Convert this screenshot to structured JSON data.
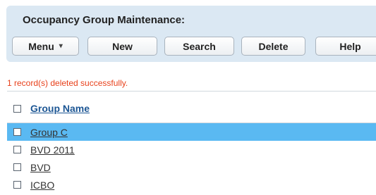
{
  "page": {
    "title": "Occupancy Group Maintenance:",
    "status_message": "1 record(s) deleted successfully."
  },
  "toolbar": {
    "menu_label": "Menu",
    "menu_caret": "▾",
    "new_label": "New",
    "search_label": "Search",
    "delete_label": "Delete",
    "help_label": "Help"
  },
  "grid": {
    "column_header": "Group Name",
    "rows": [
      {
        "name": "Group C",
        "selected": true
      },
      {
        "name": "BVD 2011",
        "selected": false
      },
      {
        "name": "BVD",
        "selected": false
      },
      {
        "name": "ICBO",
        "selected": false
      }
    ]
  },
  "colors": {
    "panel": "#dbe8f3",
    "selected_row": "#5ab9f2",
    "status_text": "#e8411b",
    "header_link": "#1c5694"
  }
}
